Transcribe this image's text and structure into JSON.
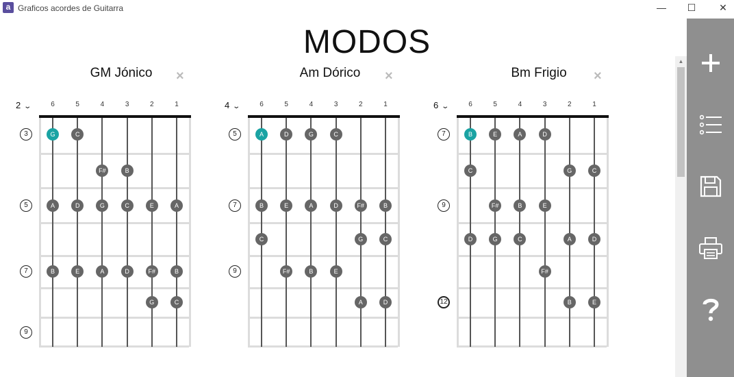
{
  "window": {
    "title": "Graficos acordes de Guitarra",
    "app_icon": "a",
    "minimize": "—",
    "maximize": "☐",
    "close": "✕"
  },
  "page": {
    "title": "MODOS"
  },
  "colors": {
    "sidebar": "#8f8f8f",
    "dot": "#666666",
    "root_dot": "#1aa3a3"
  },
  "sidebar": {
    "items": [
      "add-icon",
      "list-icon",
      "save-icon",
      "print-icon",
      "help-icon"
    ]
  },
  "strings": [
    "6",
    "5",
    "4",
    "3",
    "2",
    "1"
  ],
  "charts": [
    {
      "name": "GM Jónico",
      "start_fret": "2",
      "fret_markers": [
        {
          "row": 0,
          "label": "3"
        },
        {
          "row": 2,
          "label": "5"
        },
        {
          "row": 4,
          "label": "7"
        },
        {
          "row": 6,
          "label": "9"
        }
      ],
      "notes": [
        {
          "row": 0,
          "str": 0,
          "note": "G",
          "root": true
        },
        {
          "row": 0,
          "str": 1,
          "note": "C"
        },
        {
          "row": 1,
          "str": 2,
          "note": "F#"
        },
        {
          "row": 1,
          "str": 3,
          "note": "B"
        },
        {
          "row": 2,
          "str": 0,
          "note": "A"
        },
        {
          "row": 2,
          "str": 1,
          "note": "D"
        },
        {
          "row": 2,
          "str": 2,
          "note": "G"
        },
        {
          "row": 2,
          "str": 3,
          "note": "C"
        },
        {
          "row": 2,
          "str": 4,
          "note": "E"
        },
        {
          "row": 2,
          "str": 5,
          "note": "A"
        },
        {
          "row": 4,
          "str": 0,
          "note": "B"
        },
        {
          "row": 4,
          "str": 1,
          "note": "E"
        },
        {
          "row": 4,
          "str": 2,
          "note": "A"
        },
        {
          "row": 4,
          "str": 3,
          "note": "D"
        },
        {
          "row": 4,
          "str": 4,
          "note": "F#"
        },
        {
          "row": 4,
          "str": 5,
          "note": "B"
        },
        {
          "row": 5,
          "str": 4,
          "note": "G"
        },
        {
          "row": 5,
          "str": 5,
          "note": "C"
        }
      ]
    },
    {
      "name": "Am Dórico",
      "start_fret": "4",
      "fret_markers": [
        {
          "row": 0,
          "label": "5"
        },
        {
          "row": 2,
          "label": "7"
        },
        {
          "row": 4,
          "label": "9"
        }
      ],
      "notes": [
        {
          "row": 0,
          "str": 0,
          "note": "A",
          "root": true
        },
        {
          "row": 0,
          "str": 1,
          "note": "D"
        },
        {
          "row": 0,
          "str": 2,
          "note": "G"
        },
        {
          "row": 0,
          "str": 3,
          "note": "C"
        },
        {
          "row": 2,
          "str": 0,
          "note": "B"
        },
        {
          "row": 2,
          "str": 1,
          "note": "E"
        },
        {
          "row": 2,
          "str": 2,
          "note": "A"
        },
        {
          "row": 2,
          "str": 3,
          "note": "D"
        },
        {
          "row": 2,
          "str": 4,
          "note": "F#"
        },
        {
          "row": 2,
          "str": 5,
          "note": "B"
        },
        {
          "row": 3,
          "str": 0,
          "note": "C"
        },
        {
          "row": 3,
          "str": 4,
          "note": "G"
        },
        {
          "row": 3,
          "str": 5,
          "note": "C"
        },
        {
          "row": 4,
          "str": 1,
          "note": "F#"
        },
        {
          "row": 4,
          "str": 2,
          "note": "B"
        },
        {
          "row": 4,
          "str": 3,
          "note": "E"
        },
        {
          "row": 5,
          "str": 4,
          "note": "A"
        },
        {
          "row": 5,
          "str": 5,
          "note": "D"
        }
      ]
    },
    {
      "name": "Bm Frigio",
      "start_fret": "6",
      "fret_markers": [
        {
          "row": 0,
          "label": "7"
        },
        {
          "row": 2,
          "label": "9"
        },
        {
          "row": 5,
          "label": "12",
          "bold": true
        }
      ],
      "notes": [
        {
          "row": 0,
          "str": 0,
          "note": "B",
          "root": true
        },
        {
          "row": 0,
          "str": 1,
          "note": "E"
        },
        {
          "row": 0,
          "str": 2,
          "note": "A"
        },
        {
          "row": 0,
          "str": 3,
          "note": "D"
        },
        {
          "row": 1,
          "str": 0,
          "note": "C"
        },
        {
          "row": 1,
          "str": 4,
          "note": "G"
        },
        {
          "row": 1,
          "str": 5,
          "note": "C"
        },
        {
          "row": 2,
          "str": 1,
          "note": "F#"
        },
        {
          "row": 2,
          "str": 2,
          "note": "B"
        },
        {
          "row": 2,
          "str": 3,
          "note": "E"
        },
        {
          "row": 3,
          "str": 0,
          "note": "D"
        },
        {
          "row": 3,
          "str": 1,
          "note": "G"
        },
        {
          "row": 3,
          "str": 2,
          "note": "C"
        },
        {
          "row": 3,
          "str": 4,
          "note": "A"
        },
        {
          "row": 3,
          "str": 5,
          "note": "D"
        },
        {
          "row": 4,
          "str": 3,
          "note": "F#"
        },
        {
          "row": 5,
          "str": 4,
          "note": "B"
        },
        {
          "row": 5,
          "str": 5,
          "note": "E"
        }
      ]
    }
  ]
}
